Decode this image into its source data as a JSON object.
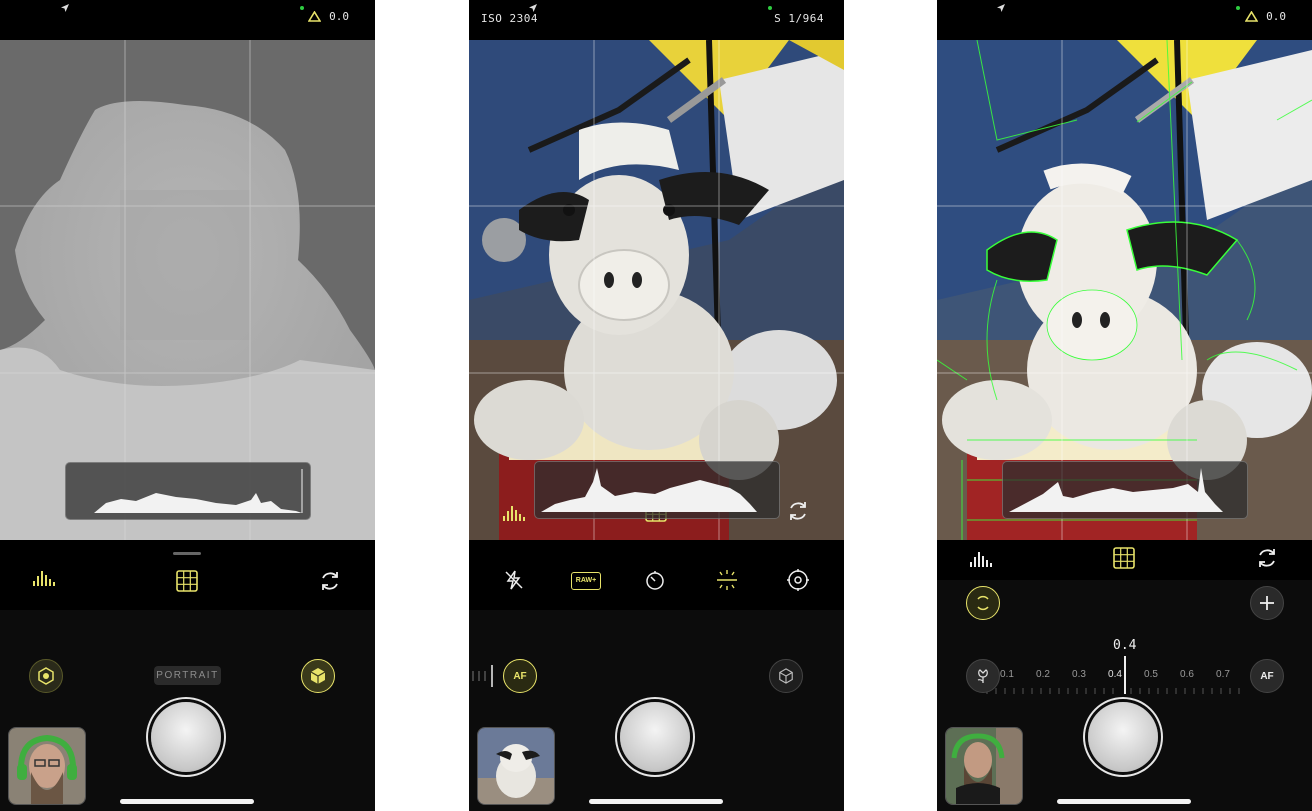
{
  "panels": [
    {
      "id": "depth",
      "status": {
        "ev": "0.0"
      },
      "mode_label": "PORTRAIT"
    },
    {
      "id": "photo",
      "status": {
        "iso": "ISO 2304",
        "shutter": "S 1/964"
      },
      "focus_mode": "AF",
      "raw_badge": "RAW+"
    },
    {
      "id": "focus-peaking",
      "status": {
        "ev": "0.0"
      },
      "focus_value": "0.4",
      "focus_mode": "AF",
      "scale_labels": [
        "0.1",
        "0.2",
        "0.3",
        "0.4",
        "0.5",
        "0.6",
        "0.7"
      ]
    }
  ],
  "colors": {
    "accent": "#e8e36a",
    "peaking": "#39ff3a",
    "background": "#0c0c0c"
  }
}
